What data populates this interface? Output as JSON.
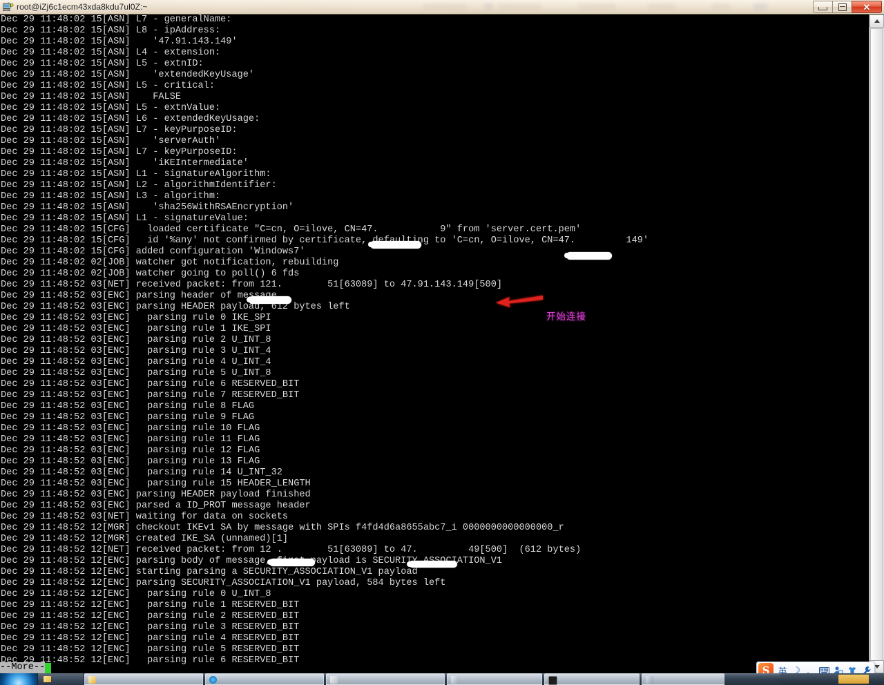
{
  "window": {
    "title": "root@iZj6c1ecm43xda8kdu7ul0Z:~",
    "icon": "putty-computer-icon",
    "buttons": {
      "minimize": "Minimize",
      "maximize": "Maximize",
      "close": "✕"
    }
  },
  "terminal": {
    "prompt": "--More--",
    "lines": [
      "Dec 29 11:48:02 15[ASN] L7 - generalName:",
      "Dec 29 11:48:02 15[ASN] L8 - ipAddress:",
      "Dec 29 11:48:02 15[ASN]    '47.91.143.149'",
      "Dec 29 11:48:02 15[ASN] L4 - extension:",
      "Dec 29 11:48:02 15[ASN] L5 - extnID:",
      "Dec 29 11:48:02 15[ASN]    'extendedKeyUsage'",
      "Dec 29 11:48:02 15[ASN] L5 - critical:",
      "Dec 29 11:48:02 15[ASN]    FALSE",
      "Dec 29 11:48:02 15[ASN] L5 - extnValue:",
      "Dec 29 11:48:02 15[ASN] L6 - extendedKeyUsage:",
      "Dec 29 11:48:02 15[ASN] L7 - keyPurposeID:",
      "Dec 29 11:48:02 15[ASN]    'serverAuth'",
      "Dec 29 11:48:02 15[ASN] L7 - keyPurposeID:",
      "Dec 29 11:48:02 15[ASN]    'iKEIntermediate'",
      "Dec 29 11:48:02 15[ASN] L1 - signatureAlgorithm:",
      "Dec 29 11:48:02 15[ASN] L2 - algorithmIdentifier:",
      "Dec 29 11:48:02 15[ASN] L3 - algorithm:",
      "Dec 29 11:48:02 15[ASN]    'sha256WithRSAEncryption'",
      "Dec 29 11:48:02 15[ASN] L1 - signatureValue:",
      "Dec 29 11:48:02 15[CFG]   loaded certificate \"C=cn, O=ilove, CN=47.           9\" from 'server.cert.pem'",
      "Dec 29 11:48:02 15[CFG]   id '%any' not confirmed by certificate, defaulting to 'C=cn, O=ilove, CN=47.         149'",
      "Dec 29 11:48:02 15[CFG] added configuration 'Windows7'",
      "Dec 29 11:48:02 02[JOB] watcher got notification, rebuilding",
      "Dec 29 11:48:02 02[JOB] watcher going to poll() 6 fds",
      "Dec 29 11:48:52 03[NET] received packet: from 121.        51[63089] to 47.91.143.149[500]",
      "Dec 29 11:48:52 03[ENC] parsing header of message",
      "Dec 29 11:48:52 03[ENC] parsing HEADER payload, 612 bytes left",
      "Dec 29 11:48:52 03[ENC]   parsing rule 0 IKE_SPI",
      "Dec 29 11:48:52 03[ENC]   parsing rule 1 IKE_SPI",
      "Dec 29 11:48:52 03[ENC]   parsing rule 2 U_INT_8",
      "Dec 29 11:48:52 03[ENC]   parsing rule 3 U_INT_4",
      "Dec 29 11:48:52 03[ENC]   parsing rule 4 U_INT_4",
      "Dec 29 11:48:52 03[ENC]   parsing rule 5 U_INT_8",
      "Dec 29 11:48:52 03[ENC]   parsing rule 6 RESERVED_BIT",
      "Dec 29 11:48:52 03[ENC]   parsing rule 7 RESERVED_BIT",
      "Dec 29 11:48:52 03[ENC]   parsing rule 8 FLAG",
      "Dec 29 11:48:52 03[ENC]   parsing rule 9 FLAG",
      "Dec 29 11:48:52 03[ENC]   parsing rule 10 FLAG",
      "Dec 29 11:48:52 03[ENC]   parsing rule 11 FLAG",
      "Dec 29 11:48:52 03[ENC]   parsing rule 12 FLAG",
      "Dec 29 11:48:52 03[ENC]   parsing rule 13 FLAG",
      "Dec 29 11:48:52 03[ENC]   parsing rule 14 U_INT_32",
      "Dec 29 11:48:52 03[ENC]   parsing rule 15 HEADER_LENGTH",
      "Dec 29 11:48:52 03[ENC] parsing HEADER payload finished",
      "Dec 29 11:48:52 03[ENC] parsed a ID_PROT message header",
      "Dec 29 11:48:52 03[NET] waiting for data on sockets",
      "Dec 29 11:48:52 12[MGR] checkout IKEv1 SA by message with SPIs f4fd4d6a8655abc7_i 0000000000000000_r",
      "Dec 29 11:48:52 12[MGR] created IKE_SA (unnamed)[1]",
      "Dec 29 11:48:52 12[NET] received packet: from 12 .        51[63089] to 47.         49[500]  (612 bytes)",
      "Dec 29 11:48:52 12[ENC] parsing body of message, first payload is SECURITY_ASSOCIATION_V1",
      "Dec 29 11:48:52 12[ENC] starting parsing a SECURITY_ASSOCIATION_V1 payload",
      "Dec 29 11:48:52 12[ENC] parsing SECURITY_ASSOCIATION_V1 payload, 584 bytes left",
      "Dec 29 11:48:52 12[ENC]   parsing rule 0 U_INT_8",
      "Dec 29 11:48:52 12[ENC]   parsing rule 1 RESERVED_BIT",
      "Dec 29 11:48:52 12[ENC]   parsing rule 2 RESERVED_BIT",
      "Dec 29 11:48:52 12[ENC]   parsing rule 3 RESERVED_BIT",
      "Dec 29 11:48:52 12[ENC]   parsing rule 4 RESERVED_BIT",
      "Dec 29 11:48:52 12[ENC]   parsing rule 5 RESERVED_BIT",
      "Dec 29 11:48:52 12[ENC]   parsing rule 6 RESERVED_BIT"
    ]
  },
  "annotation": {
    "label": "开始连接",
    "arrow": "red-left-arrow",
    "arrow_color": "#e0201c",
    "label_color": "#e040d8"
  },
  "scrollbar": {
    "up_arrow": "scroll-up-arrow",
    "down_arrow": "scroll-down-arrow"
  },
  "ime": {
    "logo": "S",
    "items": [
      {
        "icon": "language-mode-icon",
        "glyph": "英"
      },
      {
        "icon": "moon-icon",
        "glyph": "☽"
      },
      {
        "icon": "punctuation-icon",
        "glyph": "，"
      },
      {
        "icon": "soft-keyboard-icon",
        "glyph": "⌨"
      },
      {
        "icon": "user-center-icon",
        "glyph": "⚬"
      },
      {
        "icon": "skin-icon",
        "glyph": "⬟"
      },
      {
        "icon": "toolbox-icon",
        "glyph": "⚒"
      }
    ]
  },
  "taskbar": {
    "start": "start-orb",
    "clock": ""
  },
  "colors": {
    "terminal_bg": "#000000",
    "terminal_fg": "#d8d8d8",
    "accent_close": "#d4391c",
    "cursor": "#2fd52f",
    "redaction": "#ffffff"
  }
}
